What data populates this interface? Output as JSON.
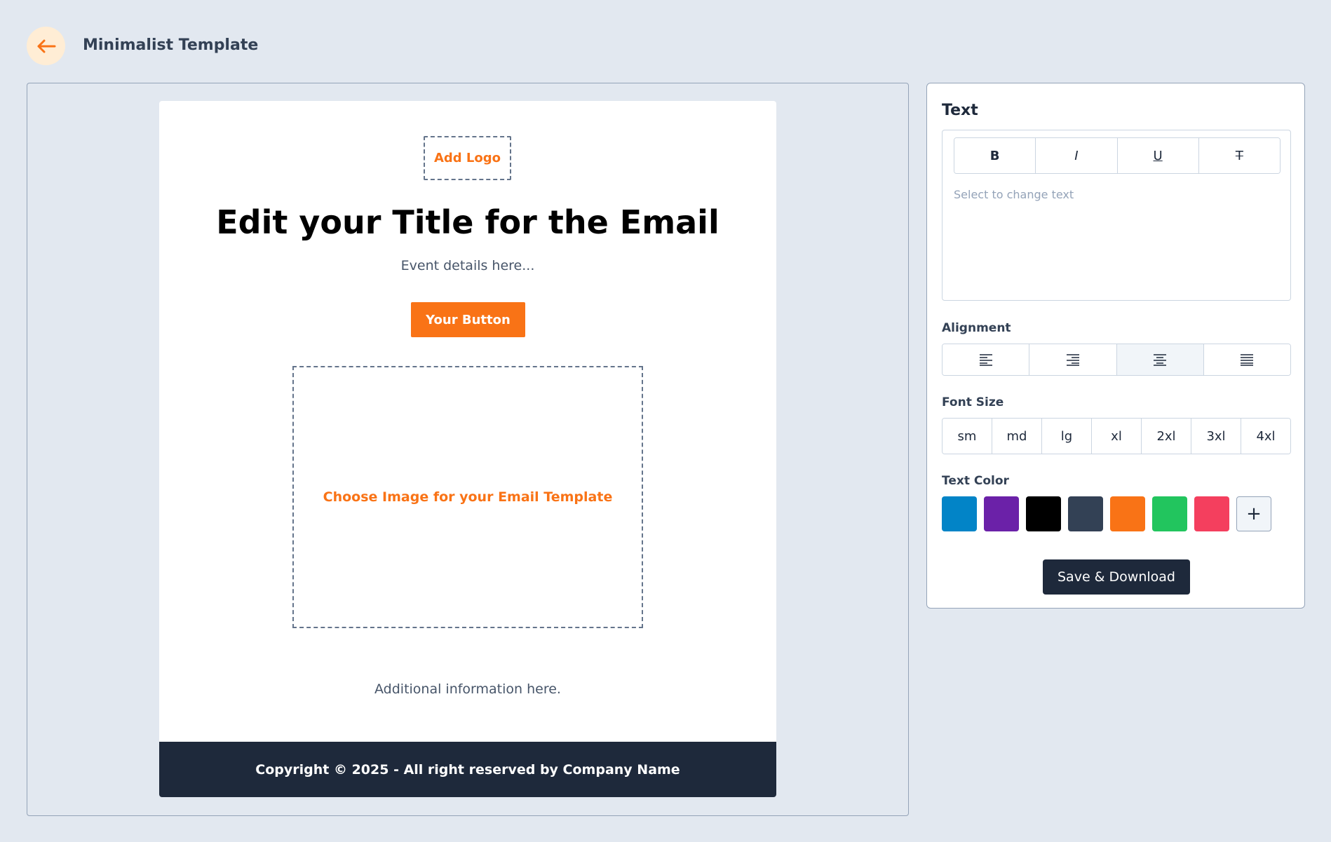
{
  "header": {
    "back_icon": "arrow-left-icon",
    "title": "Minimalist Template"
  },
  "email": {
    "logo_label": "Add Logo",
    "title": "Edit your Title for the Email",
    "event_details": "Event details here...",
    "button_label": "Your Button",
    "image_placeholder": "Choose Image for your Email Template",
    "additional_info": "Additional information here.",
    "footer": "Copyright © 2025 - All right reserved by Company Name"
  },
  "sidebar": {
    "heading": "Text",
    "format_buttons": [
      "B",
      "I",
      "U",
      "T"
    ],
    "text_placeholder": "Select to change text",
    "alignment_label": "Alignment",
    "alignment_options": [
      "left",
      "right",
      "center",
      "justify"
    ],
    "alignment_selected": "center",
    "font_size_label": "Font Size",
    "font_sizes": [
      "sm",
      "md",
      "lg",
      "xl",
      "2xl",
      "3xl",
      "4xl"
    ],
    "text_color_label": "Text Color",
    "colors": [
      "#0284c7",
      "#6b21a8",
      "#000000",
      "#334155",
      "#f97316",
      "#22c55e",
      "#f43f5e"
    ],
    "add_color_label": "+",
    "save_label": "Save & Download"
  },
  "theme": {
    "accent": "#f97316",
    "dark": "#1e293b",
    "background": "#e2e8f0"
  }
}
